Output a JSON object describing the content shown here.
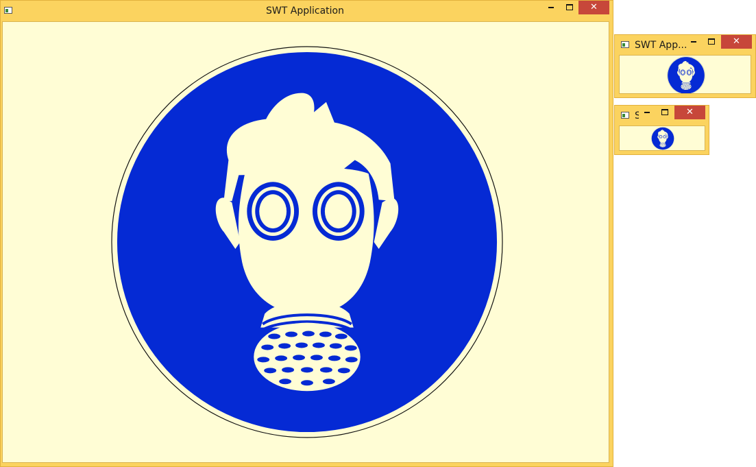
{
  "windows": {
    "main": {
      "title": "SWT Application"
    },
    "medium": {
      "title": "SWT App..."
    },
    "small": {
      "title": "S"
    }
  },
  "icons": {
    "app": "swt-app-icon",
    "minimize": "minimize-icon",
    "maximize": "maximize-icon",
    "close": "close-icon",
    "sign": "respirator-mandatory-sign-icon"
  },
  "colors": {
    "frame": "#fbd35f",
    "client_background": "#fffdd5",
    "sign_blue": "#052ad4",
    "close_button": "#c7473a"
  }
}
